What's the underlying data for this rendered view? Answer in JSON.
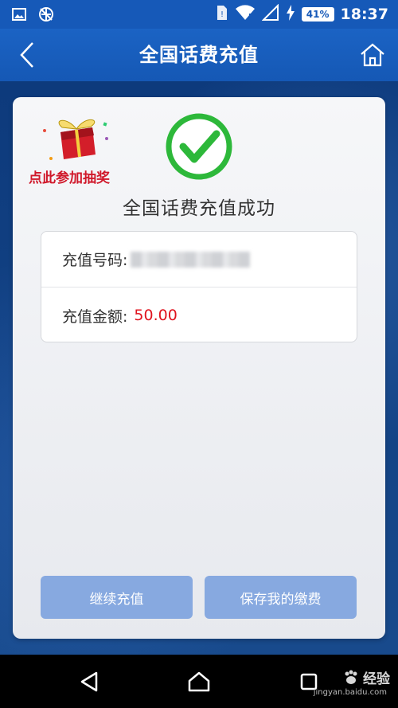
{
  "status_bar": {
    "battery": "41%",
    "time": "18:37"
  },
  "header": {
    "title": "全国话费充值"
  },
  "promo": {
    "label": "点此参加抽奖"
  },
  "result": {
    "title": "全国话费充值成功"
  },
  "details": {
    "phone_label": "充值号码:",
    "amount_label": "充值金额:",
    "amount_value": "50.00"
  },
  "actions": {
    "continue_label": "继续充值",
    "save_label": "保存我的缴费"
  },
  "watermark": {
    "text": "经验",
    "sub": "jingyan.baidu.com"
  },
  "colors": {
    "header_bg": "#1659b8",
    "success_green": "#2db83a",
    "amount_red": "#e0141f",
    "button_bg": "#87a9e0"
  }
}
